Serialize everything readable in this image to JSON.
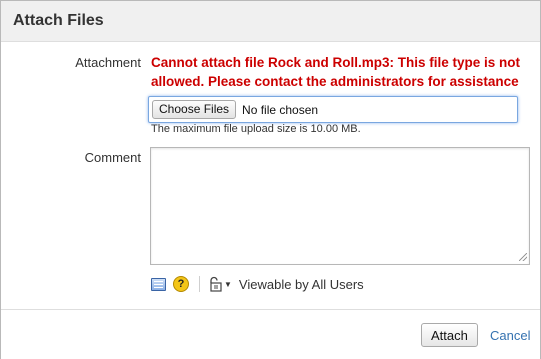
{
  "dialog": {
    "title": "Attach Files"
  },
  "attachment": {
    "label": "Attachment",
    "error_message": "Cannot attach file Rock and Roll.mp3: This file type is not allowed. Please contact the administrators for assistance",
    "choose_button": "Choose Files",
    "file_status": "No file chosen",
    "max_size_hint": "The maximum file upload size is 10.00 MB."
  },
  "comment": {
    "label": "Comment",
    "value": ""
  },
  "toolbar": {
    "wiki_icon": "wiki-markup-icon",
    "help_icon": "help-icon",
    "help_glyph": "?",
    "restrict_icon": "unlock-icon",
    "caret_glyph": "▼",
    "viewable_label": "Viewable by All Users"
  },
  "footer": {
    "attach_button": "Attach",
    "cancel_link": "Cancel"
  },
  "colors": {
    "error": "#cc0000",
    "link": "#3572b0",
    "help_badge": "#f3c518"
  }
}
